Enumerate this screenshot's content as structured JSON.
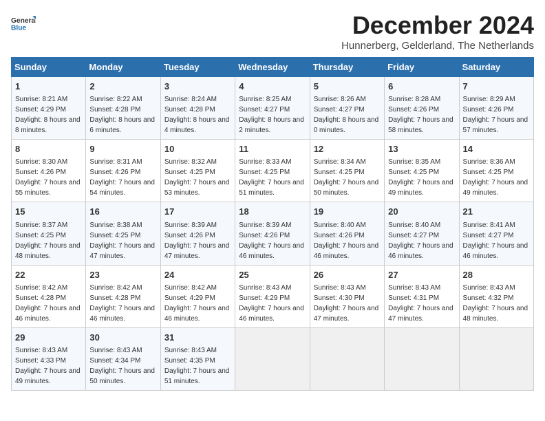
{
  "logo": {
    "line1": "General",
    "line2": "Blue"
  },
  "header": {
    "month": "December 2024",
    "location": "Hunnerberg, Gelderland, The Netherlands"
  },
  "weekdays": [
    "Sunday",
    "Monday",
    "Tuesday",
    "Wednesday",
    "Thursday",
    "Friday",
    "Saturday"
  ],
  "weeks": [
    [
      {
        "day": "1",
        "sunrise": "8:21 AM",
        "sunset": "4:29 PM",
        "daylight": "8 hours and 8 minutes."
      },
      {
        "day": "2",
        "sunrise": "8:22 AM",
        "sunset": "4:28 PM",
        "daylight": "8 hours and 6 minutes."
      },
      {
        "day": "3",
        "sunrise": "8:24 AM",
        "sunset": "4:28 PM",
        "daylight": "8 hours and 4 minutes."
      },
      {
        "day": "4",
        "sunrise": "8:25 AM",
        "sunset": "4:27 PM",
        "daylight": "8 hours and 2 minutes."
      },
      {
        "day": "5",
        "sunrise": "8:26 AM",
        "sunset": "4:27 PM",
        "daylight": "8 hours and 0 minutes."
      },
      {
        "day": "6",
        "sunrise": "8:28 AM",
        "sunset": "4:26 PM",
        "daylight": "7 hours and 58 minutes."
      },
      {
        "day": "7",
        "sunrise": "8:29 AM",
        "sunset": "4:26 PM",
        "daylight": "7 hours and 57 minutes."
      }
    ],
    [
      {
        "day": "8",
        "sunrise": "8:30 AM",
        "sunset": "4:26 PM",
        "daylight": "7 hours and 55 minutes."
      },
      {
        "day": "9",
        "sunrise": "8:31 AM",
        "sunset": "4:26 PM",
        "daylight": "7 hours and 54 minutes."
      },
      {
        "day": "10",
        "sunrise": "8:32 AM",
        "sunset": "4:25 PM",
        "daylight": "7 hours and 53 minutes."
      },
      {
        "day": "11",
        "sunrise": "8:33 AM",
        "sunset": "4:25 PM",
        "daylight": "7 hours and 51 minutes."
      },
      {
        "day": "12",
        "sunrise": "8:34 AM",
        "sunset": "4:25 PM",
        "daylight": "7 hours and 50 minutes."
      },
      {
        "day": "13",
        "sunrise": "8:35 AM",
        "sunset": "4:25 PM",
        "daylight": "7 hours and 49 minutes."
      },
      {
        "day": "14",
        "sunrise": "8:36 AM",
        "sunset": "4:25 PM",
        "daylight": "7 hours and 49 minutes."
      }
    ],
    [
      {
        "day": "15",
        "sunrise": "8:37 AM",
        "sunset": "4:25 PM",
        "daylight": "7 hours and 48 minutes."
      },
      {
        "day": "16",
        "sunrise": "8:38 AM",
        "sunset": "4:25 PM",
        "daylight": "7 hours and 47 minutes."
      },
      {
        "day": "17",
        "sunrise": "8:39 AM",
        "sunset": "4:26 PM",
        "daylight": "7 hours and 47 minutes."
      },
      {
        "day": "18",
        "sunrise": "8:39 AM",
        "sunset": "4:26 PM",
        "daylight": "7 hours and 46 minutes."
      },
      {
        "day": "19",
        "sunrise": "8:40 AM",
        "sunset": "4:26 PM",
        "daylight": "7 hours and 46 minutes."
      },
      {
        "day": "20",
        "sunrise": "8:40 AM",
        "sunset": "4:27 PM",
        "daylight": "7 hours and 46 minutes."
      },
      {
        "day": "21",
        "sunrise": "8:41 AM",
        "sunset": "4:27 PM",
        "daylight": "7 hours and 46 minutes."
      }
    ],
    [
      {
        "day": "22",
        "sunrise": "8:42 AM",
        "sunset": "4:28 PM",
        "daylight": "7 hours and 46 minutes."
      },
      {
        "day": "23",
        "sunrise": "8:42 AM",
        "sunset": "4:28 PM",
        "daylight": "7 hours and 46 minutes."
      },
      {
        "day": "24",
        "sunrise": "8:42 AM",
        "sunset": "4:29 PM",
        "daylight": "7 hours and 46 minutes."
      },
      {
        "day": "25",
        "sunrise": "8:43 AM",
        "sunset": "4:29 PM",
        "daylight": "7 hours and 46 minutes."
      },
      {
        "day": "26",
        "sunrise": "8:43 AM",
        "sunset": "4:30 PM",
        "daylight": "7 hours and 47 minutes."
      },
      {
        "day": "27",
        "sunrise": "8:43 AM",
        "sunset": "4:31 PM",
        "daylight": "7 hours and 47 minutes."
      },
      {
        "day": "28",
        "sunrise": "8:43 AM",
        "sunset": "4:32 PM",
        "daylight": "7 hours and 48 minutes."
      }
    ],
    [
      {
        "day": "29",
        "sunrise": "8:43 AM",
        "sunset": "4:33 PM",
        "daylight": "7 hours and 49 minutes."
      },
      {
        "day": "30",
        "sunrise": "8:43 AM",
        "sunset": "4:34 PM",
        "daylight": "7 hours and 50 minutes."
      },
      {
        "day": "31",
        "sunrise": "8:43 AM",
        "sunset": "4:35 PM",
        "daylight": "7 hours and 51 minutes."
      },
      null,
      null,
      null,
      null
    ]
  ]
}
